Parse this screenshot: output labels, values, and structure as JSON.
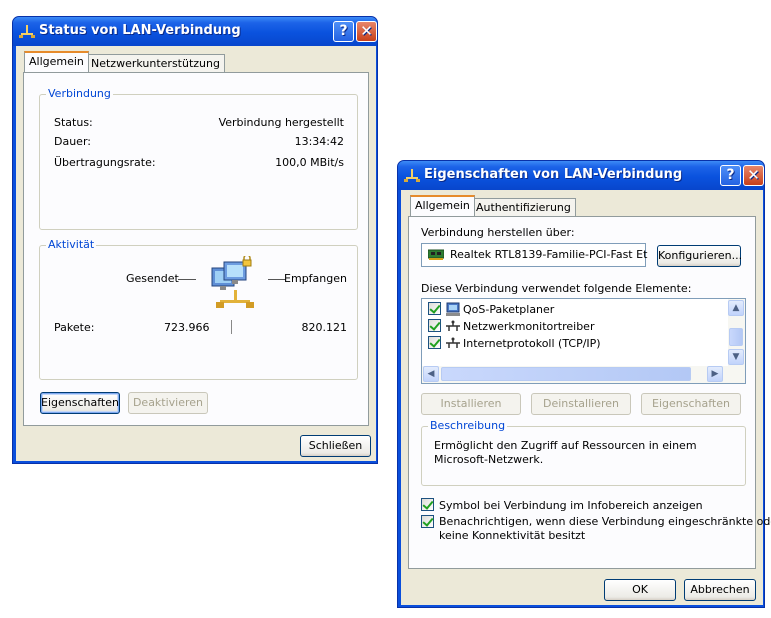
{
  "status_window": {
    "title": "Status von LAN-Verbindung",
    "tabs": [
      "Allgemein",
      "Netzwerkunterstützung"
    ],
    "connection_group": "Verbindung",
    "status_label": "Status:",
    "status_value": "Verbindung hergestellt",
    "duration_label": "Dauer:",
    "duration_value": "13:34:42",
    "rate_label": "Übertragungsrate:",
    "rate_value": "100,0 MBit/s",
    "activity_group": "Aktivität",
    "sent_label": "Gesendet",
    "received_label": "Empfangen",
    "packets_label": "Pakete:",
    "packets_sent": "723.966",
    "packets_received": "820.121",
    "properties_button": "Eigenschaften",
    "disable_button": "Deaktivieren",
    "close_button": "Schließen"
  },
  "properties_window": {
    "title": "Eigenschaften von LAN-Verbindung",
    "tabs": [
      "Allgemein",
      "Authentifizierung"
    ],
    "connect_using_label": "Verbindung herstellen über:",
    "adapter_name": "Realtek RTL8139-Familie-PCI-Fast Et",
    "configure_button": "Konfigurieren...",
    "elements_label": "Diese Verbindung verwendet folgende Elemente:",
    "elements": [
      {
        "label": "QoS-Paketplaner",
        "checked": true,
        "icon": "qos-icon"
      },
      {
        "label": "Netzwerkmonitortreiber",
        "checked": true,
        "icon": "protocol-icon"
      },
      {
        "label": "Internetprotokoll (TCP/IP)",
        "checked": true,
        "icon": "protocol-icon"
      }
    ],
    "install_button": "Installieren",
    "uninstall_button": "Deinstallieren",
    "properties_button": "Eigenschaften",
    "description_group": "Beschreibung",
    "description_text_line1": "Ermöglicht den Zugriff auf Ressourcen in einem",
    "description_text_line2": "Microsoft-Netzwerk.",
    "show_icon_checkbox": "Symbol bei Verbindung im Infobereich anzeigen",
    "show_icon_checked": true,
    "notify_checkbox_line1": "Benachrichtigen, wenn diese Verbindung eingeschränkte oder",
    "notify_checkbox_line2": "keine Konnektivität besitzt",
    "notify_checked": true,
    "ok_button": "OK",
    "cancel_button": "Abbrechen"
  },
  "colors": {
    "titlebar": "#0a52de",
    "dialog_bg": "#ece9d8",
    "group_label": "#0046d5",
    "active_tab_accent": "#e68b2c"
  }
}
